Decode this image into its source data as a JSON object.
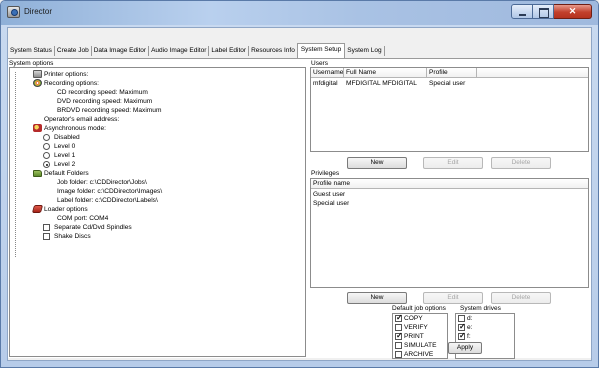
{
  "window": {
    "title": "Director"
  },
  "tabs": [
    {
      "label": "System Status",
      "active": false
    },
    {
      "label": "Create Job",
      "active": false
    },
    {
      "label": "Data Image Editor",
      "active": false
    },
    {
      "label": "Audio Image Editor",
      "active": false
    },
    {
      "label": "Label Editor",
      "active": false
    },
    {
      "label": "Resources Info",
      "active": false
    },
    {
      "label": "System Setup",
      "active": true
    },
    {
      "label": "System Log",
      "active": false
    }
  ],
  "system_options": {
    "label": "System options",
    "tree": [
      {
        "text": "Printer options:",
        "icon": "printer-icon"
      },
      {
        "text": "Recording options:",
        "icon": "disc-icon"
      },
      {
        "text": "CD recording speed: Maximum"
      },
      {
        "text": "DVD recording speed: Maximum"
      },
      {
        "text": "BRDVD recording speed: Maximum"
      },
      {
        "text": "Operator's email address:"
      },
      {
        "text": "Asynchronous mode:",
        "icon": "async-icon"
      },
      {
        "text": "Disabled",
        "radio": true,
        "checked": false
      },
      {
        "text": "Level 0",
        "radio": true,
        "checked": false
      },
      {
        "text": "Level 1",
        "radio": true,
        "checked": false
      },
      {
        "text": "Level 2",
        "radio": true,
        "checked": true
      },
      {
        "text": "Default Folders",
        "icon": "folder-icon"
      },
      {
        "text": "Job folder: c:\\CDDirector\\Jobs\\"
      },
      {
        "text": "Image folder: c:\\CDDirector\\Images\\"
      },
      {
        "text": "Label folder: c:\\CDDirector\\Labels\\"
      },
      {
        "text": "Loader options",
        "icon": "loader-icon"
      },
      {
        "text": "COM port: COM4"
      },
      {
        "text": "Separate Cd/Dvd Spindles",
        "checkbox": true,
        "checked": false
      },
      {
        "text": "Shake Discs",
        "checkbox": true,
        "checked": false
      }
    ]
  },
  "users": {
    "label": "Users",
    "columns": [
      "Username",
      "Full Name",
      "Profile"
    ],
    "rows": [
      [
        "mfdigital",
        "MFDIGITAL MFDIGITAL",
        "Special user"
      ]
    ],
    "buttons": {
      "new": "New",
      "edit": "Edit",
      "delete": "Delete"
    }
  },
  "privileges": {
    "label": "Privileges",
    "column": "Profile name",
    "rows": [
      "Guest user",
      "Special user"
    ],
    "buttons": {
      "new": "New",
      "edit": "Edit",
      "delete": "Delete"
    }
  },
  "default_job_options": {
    "label": "Default job options",
    "items": [
      {
        "text": "COPY",
        "checked": true
      },
      {
        "text": "VERIFY",
        "checked": false
      },
      {
        "text": "PRINT",
        "checked": true
      },
      {
        "text": "SIMULATE",
        "checked": false
      },
      {
        "text": "ARCHIVE",
        "checked": false
      }
    ]
  },
  "system_drives": {
    "label": "System drives",
    "items": [
      {
        "text": "d:",
        "checked": false
      },
      {
        "text": "e:",
        "checked": true
      },
      {
        "text": "f:",
        "checked": true
      }
    ]
  },
  "apply_label": "Apply"
}
